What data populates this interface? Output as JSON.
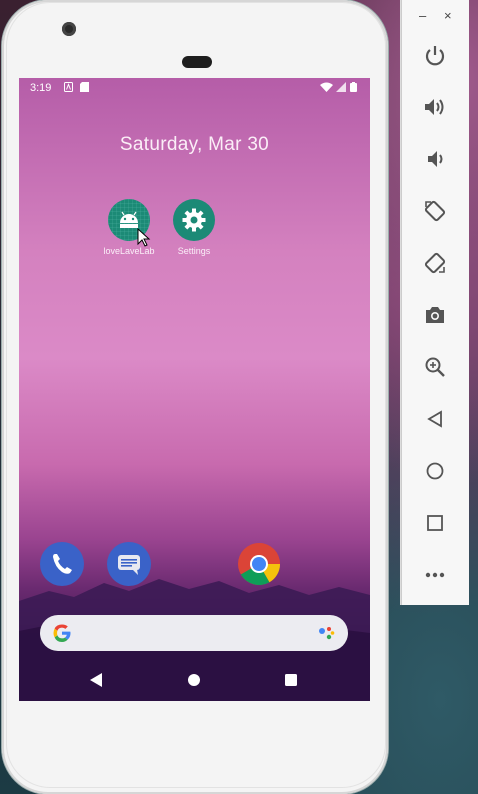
{
  "status_bar": {
    "time": "3:19"
  },
  "home": {
    "date": "Saturday, Mar 30",
    "apps": [
      {
        "label": "loveLaveLab",
        "icon": "android-icon"
      },
      {
        "label": "Settings",
        "icon": "gear-icon"
      }
    ],
    "dock": [
      "phone-icon",
      "messages-icon",
      "chrome-icon"
    ]
  },
  "colors": {
    "app_icon_bg": "#1c8a76",
    "wallpaper_top": "#b55da8",
    "wallpaper_bottom": "#2c1440",
    "panel_icon": "#555555"
  },
  "emulator_panel": {
    "window_controls": {
      "minimize": "–",
      "close": "×"
    },
    "buttons": [
      "power-icon",
      "volume-up-icon",
      "volume-down-icon",
      "rotate-left-icon",
      "rotate-right-icon",
      "screenshot-icon",
      "zoom-icon",
      "back-icon",
      "home-icon",
      "overview-icon",
      "more-icon"
    ]
  }
}
